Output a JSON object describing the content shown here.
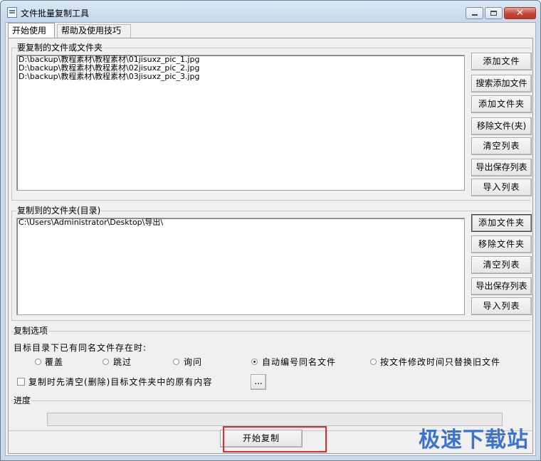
{
  "window": {
    "title": "文件批量复制工具",
    "minimize_label": "",
    "close_glyph": "✕"
  },
  "tabs": [
    {
      "label": "开始使用",
      "active": true
    },
    {
      "label": "帮助及使用技巧",
      "active": false
    }
  ],
  "source_group": {
    "label": "要复制的文件或文件夹",
    "files": [
      "D:\\backup\\教程素材\\教程素材\\01jisuxz_pic_1.jpg",
      "D:\\backup\\教程素材\\教程素材\\02jisuxz_pic_2.jpg",
      "D:\\backup\\教程素材\\教程素材\\03jisuxz_pic_3.jpg"
    ],
    "buttons": {
      "add_file": "添加文件",
      "search_add_file": "搜索添加文件",
      "add_folder": "添加文件夹",
      "remove": "移除文件(夹)",
      "clear_list": "清空列表",
      "export_list": "导出保存列表",
      "import_list": "导入列表"
    }
  },
  "dest_group": {
    "label": "复制到的文件夹(目录)",
    "folders": [
      "C:\\Users\\Administrator\\Desktop\\导出\\"
    ],
    "buttons": {
      "add_folder": "添加文件夹",
      "remove_folder": "移除文件夹",
      "clear_list": "清空列表",
      "export_list": "导出保存列表",
      "import_list": "导入列表"
    }
  },
  "options_group": {
    "label": "复制选项",
    "prompt": "目标目录下已有同名文件存在时:",
    "radio_options": [
      {
        "label": "覆盖",
        "checked": false
      },
      {
        "label": "跳过",
        "checked": false
      },
      {
        "label": "询问",
        "checked": false
      },
      {
        "label": "自动编号同名文件",
        "checked": true
      },
      {
        "label": "按文件修改时间只替换旧文件",
        "checked": false
      }
    ],
    "clear_target_label": "复制时先清空(删除)目标文件夹中的原有内容",
    "clear_target_checked": false,
    "more_button": "..."
  },
  "progress_group": {
    "label": "进度",
    "value": 0
  },
  "start_button": "开始复制",
  "watermark": "极速下载站",
  "colors": {
    "highlight": "#e02b2b",
    "watermark": "#2a66c4"
  }
}
